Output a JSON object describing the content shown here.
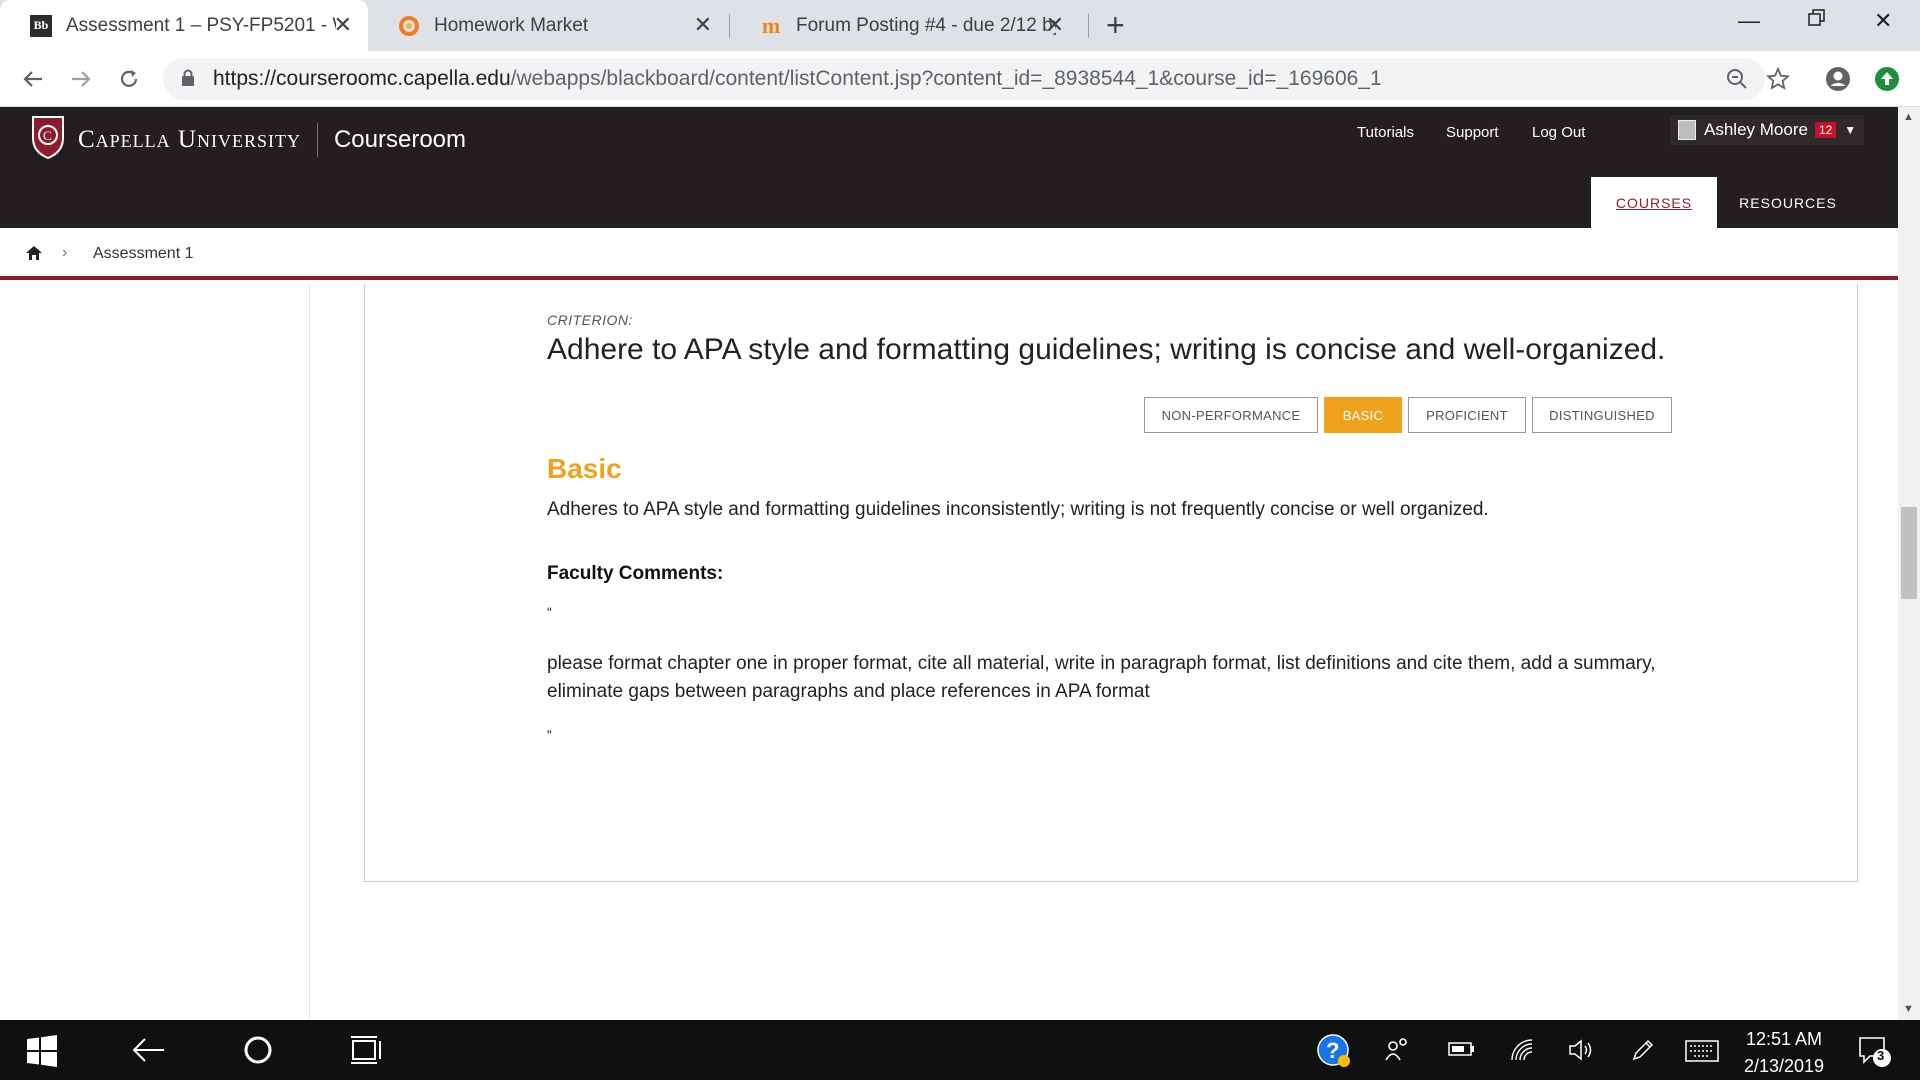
{
  "browser": {
    "tabs": [
      {
        "title": "Assessment 1 – PSY-FP5201 - Wi",
        "favicon": "Bb",
        "active": true
      },
      {
        "title": "Homework Market",
        "favicon": "homework-market-logo",
        "active": false
      },
      {
        "title": "Forum Posting #4 - due 2/12 by",
        "favicon": "m",
        "active": false
      }
    ],
    "url_host": "https://courseroomc.capella.edu",
    "url_path": "/webapps/blackboard/content/listContent.jsp?content_id=_8938544_1&course_id=_169606_1"
  },
  "site": {
    "brand": "Capella University",
    "section": "Courseroom",
    "links": [
      "Tutorials",
      "Support",
      "Log Out"
    ],
    "user_name": "Ashley Moore",
    "notifications": "12",
    "nav_tabs": [
      "COURSES",
      "RESOURCES"
    ],
    "accent": "#8c1d2d"
  },
  "breadcrumb": {
    "current": "Assessment 1"
  },
  "rubric": {
    "criterion_label": "CRITERION:",
    "criterion": "Adhere to APA style and formatting guidelines; writing is concise and well-organized.",
    "levels": [
      "NON-PERFORMANCE",
      "BASIC",
      "PROFICIENT",
      "DISTINGUISHED"
    ],
    "selected_level": "BASIC",
    "level_color": "#efa31d",
    "level_heading": "Basic",
    "level_description": "Adheres to APA style and formatting guidelines inconsistently; writing is not frequently concise or well organized.",
    "faculty_heading": "Faculty Comments:",
    "open_quote": "“",
    "close_quote": "”",
    "faculty_comment": "please format chapter one in proper format, cite all material, write in paragraph format, list definitions and cite them, add a summary, eliminate gaps between paragraphs and place references in APA format"
  },
  "taskbar": {
    "time": "12:51 AM",
    "date": "2/13/2019",
    "notification_count": "3"
  }
}
